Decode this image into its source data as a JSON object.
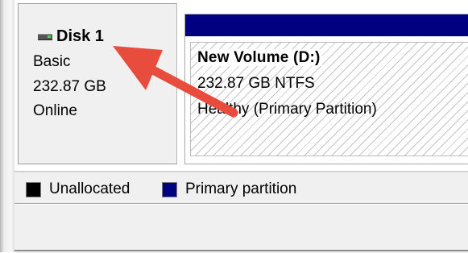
{
  "disk": {
    "title": "Disk 1",
    "type": "Basic",
    "size": "232.87 GB",
    "status": "Online",
    "icon": "disk-drive-icon"
  },
  "partition": {
    "volume_name": "New Volume  (D:)",
    "size_fs": "232.87 GB NTFS",
    "health": "Healthy (Primary Partition)",
    "bar_color": "#000080"
  },
  "legend": {
    "items": [
      {
        "label": "Unallocated",
        "color": "#000000"
      },
      {
        "label": "Primary partition",
        "color": "#000080"
      }
    ]
  },
  "annotation": {
    "arrow_color": "#e74c3c",
    "points_to": "disk-title"
  }
}
